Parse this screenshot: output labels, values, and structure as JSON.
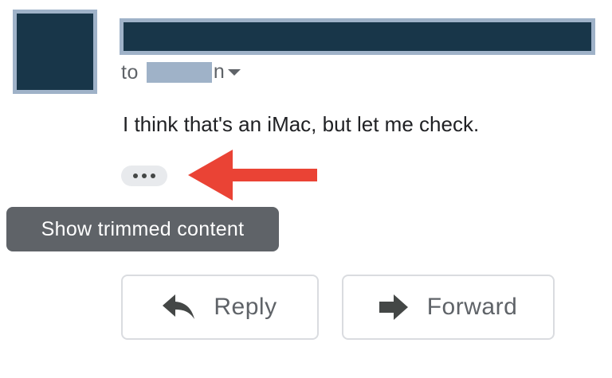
{
  "recipient": {
    "prefix": "to",
    "name_tail": "n",
    "caret_icon": "chevron-down-icon"
  },
  "message": {
    "body": "I think that's an iMac, but let me check."
  },
  "trim_button": {
    "icon": "more-horiz-icon"
  },
  "tooltip": {
    "text": "Show trimmed content"
  },
  "annotation": {
    "icon": "left-arrow-icon",
    "color": "#ea4335"
  },
  "actions": {
    "reply_label": "Reply",
    "reply_icon": "reply-icon",
    "forward_label": "Forward",
    "forward_icon": "forward-icon"
  },
  "colors": {
    "redaction_fill": "#183649",
    "redaction_border": "#9fb2c8",
    "tooltip_bg": "#5f6368"
  }
}
